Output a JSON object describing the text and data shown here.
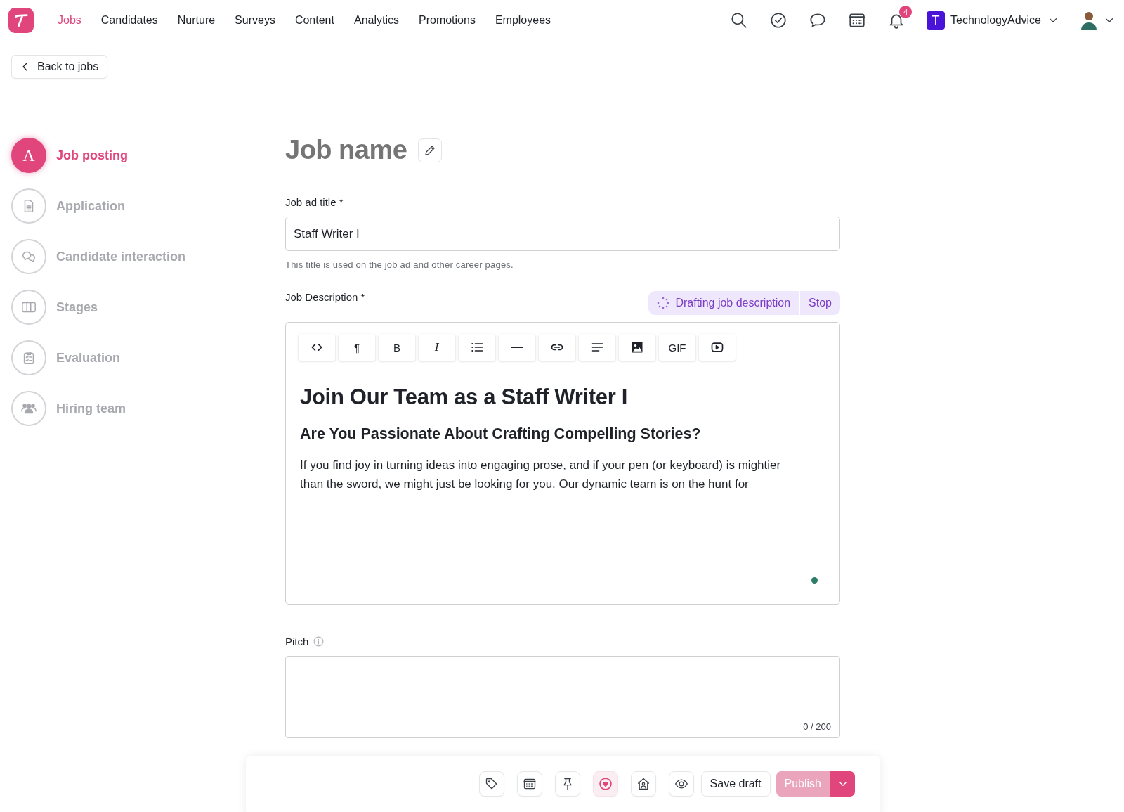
{
  "nav": {
    "items": [
      {
        "label": "Jobs",
        "selected": true
      },
      {
        "label": "Candidates",
        "selected": false
      },
      {
        "label": "Nurture",
        "selected": false
      },
      {
        "label": "Surveys",
        "selected": false
      },
      {
        "label": "Content",
        "selected": false
      },
      {
        "label": "Analytics",
        "selected": false
      },
      {
        "label": "Promotions",
        "selected": false
      },
      {
        "label": "Employees",
        "selected": false
      }
    ],
    "notification_count": "4",
    "org": {
      "initial": "T",
      "name": "TechnologyAdvice"
    }
  },
  "back_button": "Back to jobs",
  "steps": [
    {
      "label": "Job posting",
      "selected": true,
      "kind": "letter",
      "badge": "A"
    },
    {
      "label": "Application",
      "selected": false,
      "kind": "document"
    },
    {
      "label": "Candidate interaction",
      "selected": false,
      "kind": "chat"
    },
    {
      "label": "Stages",
      "selected": false,
      "kind": "columns"
    },
    {
      "label": "Evaluation",
      "selected": false,
      "kind": "clipboard"
    },
    {
      "label": "Hiring team",
      "selected": false,
      "kind": "people"
    }
  ],
  "job_name": {
    "placeholder": "Job name"
  },
  "job_ad_title": {
    "label": "Job ad title *",
    "value": "Staff Writer I",
    "hint": "This title is used on the job ad and other career pages."
  },
  "job_description": {
    "label": "Job Description *",
    "drafting": {
      "status": "Drafting job description",
      "stop": "Stop"
    },
    "toolbar": [
      {
        "kind": "code"
      },
      {
        "kind": "glyph",
        "label": "¶"
      },
      {
        "kind": "glyph",
        "label": "B"
      },
      {
        "kind": "italic",
        "label": "I"
      },
      {
        "kind": "list"
      },
      {
        "kind": "rule"
      },
      {
        "kind": "link"
      },
      {
        "kind": "align"
      },
      {
        "kind": "image"
      },
      {
        "kind": "glyph",
        "label": "GIF"
      },
      {
        "kind": "video"
      }
    ],
    "heading": "Join Our Team as a Staff Writer I",
    "subheading": "Are You Passionate About Crafting Compelling Stories?",
    "paragraph": "If you find joy in turning ideas into engaging prose, and if your pen (or keyboard) is mightier than the sword, we might just be looking for you. Our dynamic team is on the hunt for"
  },
  "pitch": {
    "label": "Pitch",
    "counter": "0 / 200"
  },
  "actions": {
    "tools": [
      {
        "kind": "tag",
        "selected": false
      },
      {
        "kind": "calendar",
        "selected": false
      },
      {
        "kind": "pin",
        "selected": false
      },
      {
        "kind": "heart",
        "selected": true
      },
      {
        "kind": "house",
        "selected": false
      },
      {
        "kind": "eye",
        "selected": false
      }
    ],
    "save": "Save draft",
    "publish": {
      "label": "Publish",
      "disabled": true
    }
  }
}
